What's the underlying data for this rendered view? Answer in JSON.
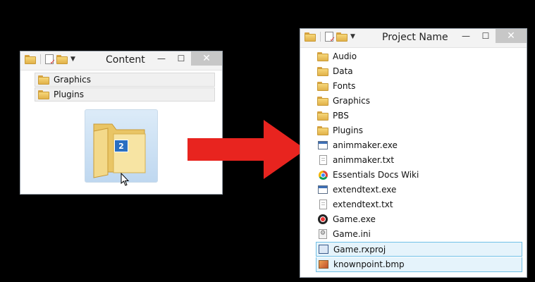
{
  "left_window": {
    "title": "Content",
    "items": [
      {
        "label": "Graphics",
        "icon": "folder-icon"
      },
      {
        "label": "Plugins",
        "icon": "folder-icon"
      }
    ],
    "drag_badge": "2"
  },
  "right_window": {
    "title": "Project Name",
    "items": [
      {
        "label": "Audio",
        "icon": "folder-icon"
      },
      {
        "label": "Data",
        "icon": "folder-icon"
      },
      {
        "label": "Fonts",
        "icon": "folder-icon"
      },
      {
        "label": "Graphics",
        "icon": "folder-icon"
      },
      {
        "label": "PBS",
        "icon": "folder-icon"
      },
      {
        "label": "Plugins",
        "icon": "folder-icon"
      },
      {
        "label": "animmaker.exe",
        "icon": "exe-icon"
      },
      {
        "label": "animmaker.txt",
        "icon": "text-file-icon"
      },
      {
        "label": "Essentials Docs Wiki",
        "icon": "chrome-icon"
      },
      {
        "label": "extendtext.exe",
        "icon": "exe-icon"
      },
      {
        "label": "extendtext.txt",
        "icon": "text-file-icon"
      },
      {
        "label": "Game.exe",
        "icon": "game-icon"
      },
      {
        "label": "Game.ini",
        "icon": "ini-icon"
      },
      {
        "label": "Game.rxproj",
        "icon": "project-icon"
      },
      {
        "label": "knownpoint.bmp",
        "icon": "bitmap-icon"
      }
    ]
  },
  "colors": {
    "arrow": "#e8241f",
    "background": "#000000",
    "selection": "#e5f3fb"
  }
}
